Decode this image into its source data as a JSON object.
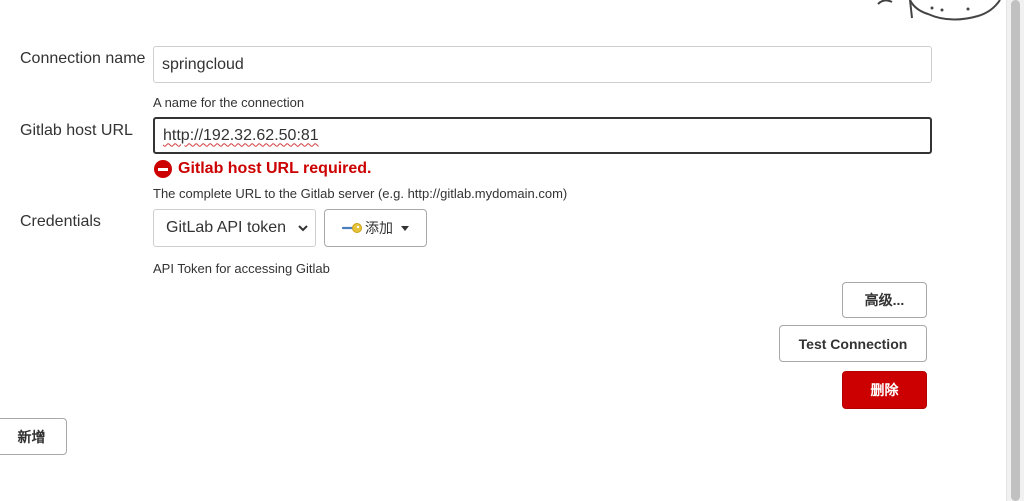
{
  "form": {
    "connection_name": {
      "label": "Connection name",
      "value": "springcloud",
      "help": "A name for the connection"
    },
    "host_url": {
      "label": "Gitlab host URL",
      "value": "http://192.32.62.50:81",
      "error": "Gitlab host URL required.",
      "help": "The complete URL to the Gitlab server (e.g. http://gitlab.mydomain.com)"
    },
    "credentials": {
      "label": "Credentials",
      "selected": "GitLab API token",
      "add_label": "添加",
      "help": "API Token for accessing Gitlab"
    }
  },
  "buttons": {
    "advanced": "高级...",
    "test_connection": "Test Connection",
    "delete": "删除",
    "add_new": "新增"
  },
  "colors": {
    "error": "#cc0000",
    "delete_button": "#cc0000"
  },
  "icons": {
    "error": "error-circle-icon",
    "key": "key-icon",
    "select_arrow": "chevron-down-icon",
    "dropdown": "caret-down-icon"
  }
}
